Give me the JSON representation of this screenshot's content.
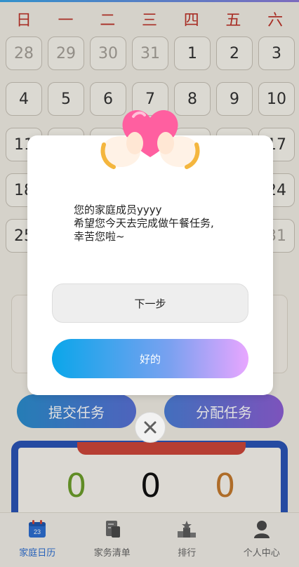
{
  "calendar": {
    "weekdays": [
      "日",
      "一",
      "二",
      "三",
      "四",
      "五",
      "六"
    ],
    "days": [
      [
        "28",
        "29",
        "30",
        "31",
        "1",
        "2",
        "3"
      ],
      [
        "4",
        "5",
        "6",
        "7",
        "8",
        "9",
        "10"
      ],
      [
        "11",
        "",
        "",
        "",
        "",
        "",
        "17"
      ],
      [
        "18",
        "",
        "",
        "",
        "",
        "",
        "24"
      ],
      [
        "25",
        "",
        "",
        "",
        "",
        "",
        "31"
      ]
    ]
  },
  "actions": {
    "submit_label": "提交任务",
    "assign_label": "分配任务"
  },
  "stats": {
    "values": [
      "0",
      "0",
      "0"
    ],
    "colors": [
      "#6ea02b",
      "#111111",
      "#c77b2e"
    ]
  },
  "bottom_nav": {
    "items": [
      {
        "label": "家庭日历",
        "icon": "calendar-icon",
        "badge": "23",
        "active": true
      },
      {
        "label": "家务清单",
        "icon": "document-icon",
        "active": false
      },
      {
        "label": "排行",
        "icon": "trophy-podium-icon",
        "active": false
      },
      {
        "label": "个人中心",
        "icon": "user-icon",
        "active": false
      }
    ]
  },
  "modal": {
    "lines": [
      "您的家庭成员yyyy",
      "希望您今天去完成做午餐任务,",
      "幸苦您啦~"
    ],
    "next_label": "下一步",
    "ok_label": "好的"
  },
  "colors": {
    "accent_blue": "#2d6fd3",
    "weekday_red": "#c0352b",
    "gradient_start": "#0aa6ea",
    "gradient_end": "#e8a6ff"
  }
}
